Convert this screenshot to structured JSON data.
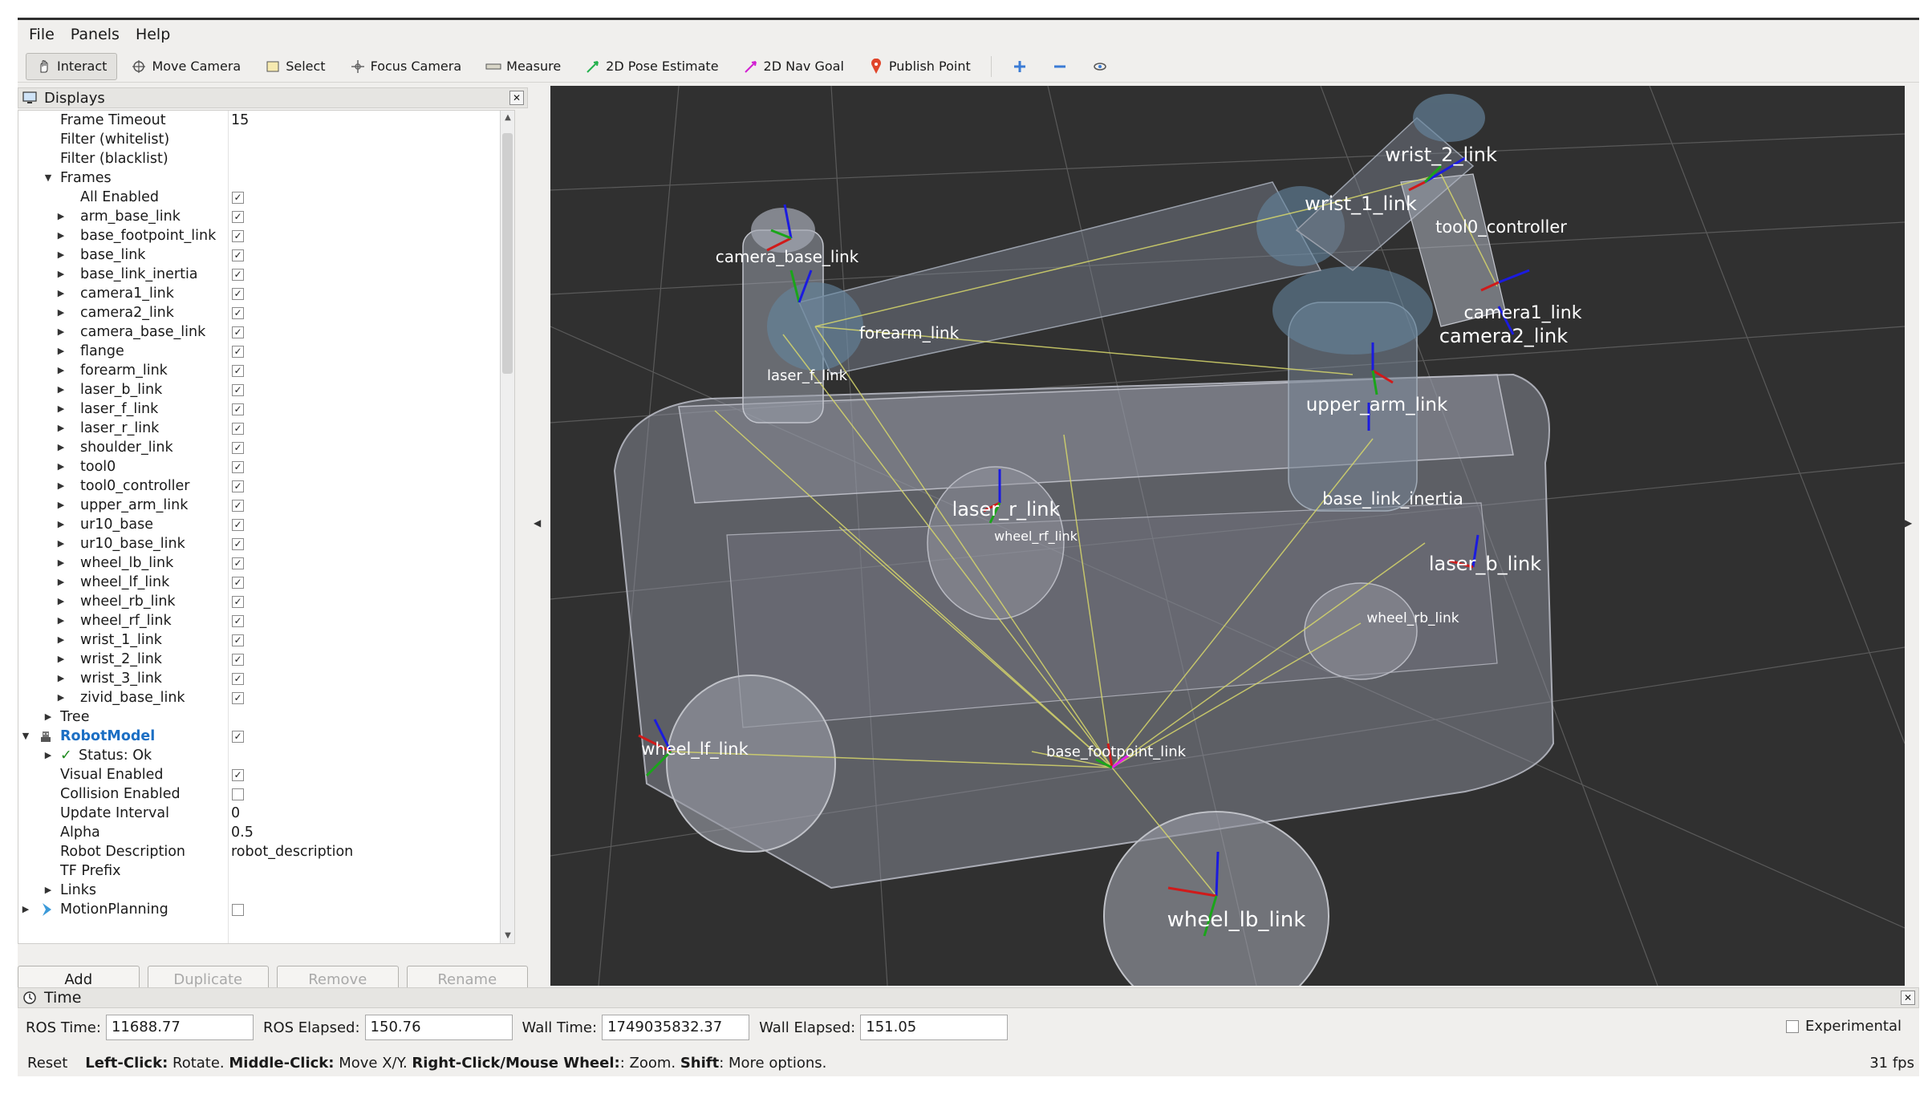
{
  "menu": [
    "File",
    "Panels",
    "Help"
  ],
  "toolbar": {
    "interact": "Interact",
    "move_camera": "Move Camera",
    "select": "Select",
    "focus_camera": "Focus Camera",
    "measure": "Measure",
    "pose_estimate": "2D Pose Estimate",
    "nav_goal": "2D Nav Goal",
    "publish_point": "Publish Point"
  },
  "displays": {
    "title": "Displays",
    "frame_timeout_label": "Frame Timeout",
    "frame_timeout_value": "15",
    "filter_whitelist": "Filter (whitelist)",
    "filter_blacklist": "Filter (blacklist)",
    "frames_label": "Frames",
    "all_enabled": "All Enabled",
    "frames": [
      "arm_base_link",
      "base_footpoint_link",
      "base_link",
      "base_link_inertia",
      "camera1_link",
      "camera2_link",
      "camera_base_link",
      "flange",
      "forearm_link",
      "laser_b_link",
      "laser_f_link",
      "laser_r_link",
      "shoulder_link",
      "tool0",
      "tool0_controller",
      "upper_arm_link",
      "ur10_base",
      "ur10_base_link",
      "wheel_lb_link",
      "wheel_lf_link",
      "wheel_rb_link",
      "wheel_rf_link",
      "wrist_1_link",
      "wrist_2_link",
      "wrist_3_link",
      "zivid_base_link"
    ],
    "tree_label": "Tree",
    "robot_model_label": "RobotModel",
    "status_label": "Status: Ok",
    "visual_enabled": "Visual Enabled",
    "collision_enabled": "Collision Enabled",
    "update_interval_label": "Update Interval",
    "update_interval_value": "0",
    "alpha_label": "Alpha",
    "alpha_value": "0.5",
    "robot_description_label": "Robot Description",
    "robot_description_value": "robot_description",
    "tf_prefix_label": "TF Prefix",
    "links_label": "Links",
    "motion_planning_label": "MotionPlanning"
  },
  "buttons": {
    "add": "Add",
    "duplicate": "Duplicate",
    "remove": "Remove",
    "rename": "Rename"
  },
  "viewport_labels": {
    "wrist_2": "wrist_2_link",
    "wrist_1": "wrist_1_link",
    "tool_cluster": "tool0_controller",
    "camera_base": "camera_base_link",
    "forearm": "forearm_link",
    "laser_f": "laser_f_link",
    "camera1": "camera1_link",
    "camera2": "camera2_link",
    "upper_arm": "upper_arm_link",
    "laser_r": "laser_r_link",
    "wheel_rf": "wheel_rf_link",
    "base_cluster": "base_link_inertia",
    "laser_b": "laser_b_link",
    "wheel_rb": "wheel_rb_link",
    "wheel_lf": "wheel_lf_link",
    "base_foot": "base_footpoint_link",
    "wheel_lb": "wheel_lb_link"
  },
  "time": {
    "title": "Time",
    "ros_time_label": "ROS Time:",
    "ros_time": "11688.77",
    "ros_elapsed_label": "ROS Elapsed:",
    "ros_elapsed": "150.76",
    "wall_time_label": "Wall Time:",
    "wall_time": "1749035832.37",
    "wall_elapsed_label": "Wall Elapsed:",
    "wall_elapsed": "151.05",
    "experimental": "Experimental"
  },
  "status": {
    "reset": "Reset",
    "left_click": "Left-Click:",
    "left_click_desc": " Rotate. ",
    "middle_click": "Middle-Click:",
    "middle_click_desc": " Move X/Y. ",
    "right_click": "Right-Click/Mouse Wheel:",
    "right_click_desc": ": Zoom. ",
    "shift": "Shift",
    "shift_desc": ": More options.",
    "fps": "31 fps"
  },
  "colors": {
    "viewport_bg": "#303030",
    "robot_model_blue": "#1c6fc4",
    "tf_yellow": "#d6d66b"
  }
}
